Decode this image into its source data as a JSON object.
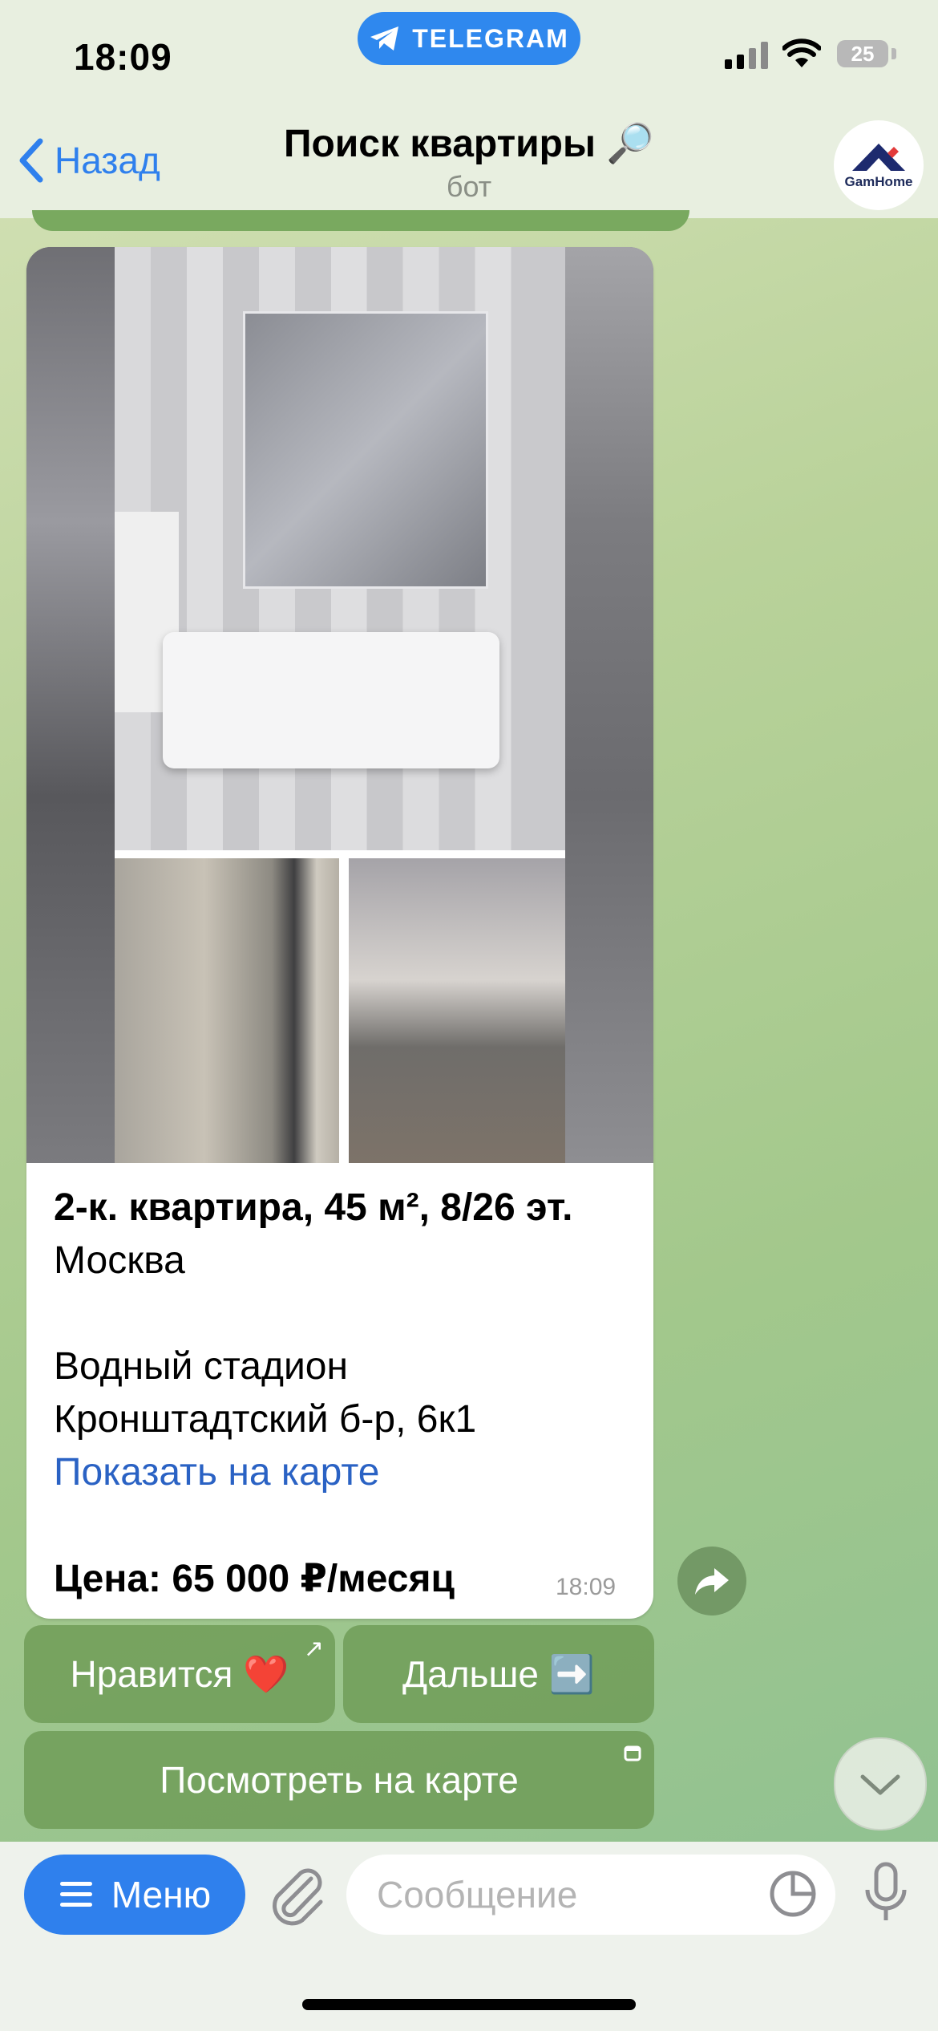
{
  "status_bar": {
    "time": "18:09",
    "battery": "25",
    "return_app": "TELEGRAM"
  },
  "header": {
    "back_label": "Назад",
    "title": "Поиск квартиры 🔎",
    "subtitle": "бот",
    "avatar_label": "GamHome"
  },
  "message": {
    "title": "2-к. квартира, 45 м², 8/26 эт.",
    "city": "Москва",
    "metro": "Водный стадион",
    "address": "Кронштадтский б-р, 6к1",
    "map_link": "Показать на карте",
    "price": "Цена: 65 000 ₽/месяц",
    "time": "18:09",
    "photos": [
      "bathroom-sink-photo",
      "dining-room-photo",
      "living-room-photo"
    ]
  },
  "inline_keyboard": {
    "like": "Нравится ❤️",
    "like_corner": "↗",
    "next": "Дальше ➡️",
    "view_map": "Посмотреть на карте"
  },
  "composer": {
    "menu_label": "Меню",
    "placeholder": "Сообщение"
  },
  "icons": [
    "telegram-icon",
    "signal-icon",
    "wifi-icon",
    "battery-icon",
    "back-chevron-icon",
    "share-icon",
    "chevron-down-icon",
    "menu-lines-icon",
    "paperclip-icon",
    "sticker-icon",
    "microphone-icon",
    "web-app-icon"
  ],
  "colors": {
    "accent": "#2f80ed",
    "bot_button": "#6e9b55",
    "link": "#2a62c4"
  }
}
